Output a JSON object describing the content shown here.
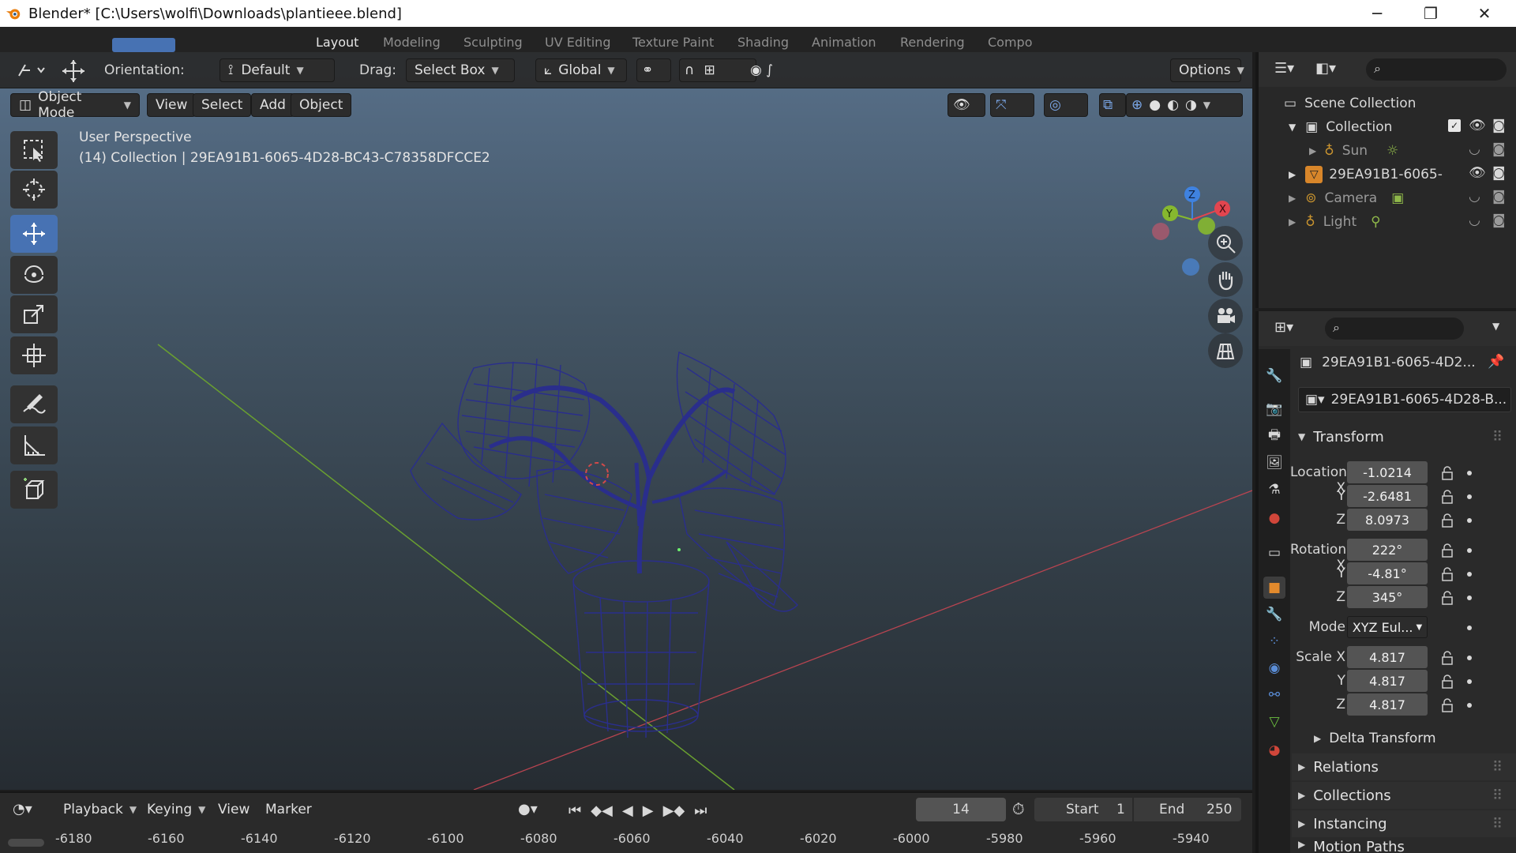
{
  "window": {
    "title": "Blender* [C:\\Users\\wolfi\\Downloads\\plantieee.blend]",
    "minimize_glyph": "─",
    "restore_glyph": "❐",
    "close_glyph": "✕"
  },
  "workspace_tabs": [
    "Layout",
    "Modeling",
    "Sculpting",
    "UV Editing",
    "Texture Paint",
    "Shading",
    "Animation",
    "Rendering",
    "Compo"
  ],
  "viewport_header": {
    "orientation_label": "Orientation:",
    "orientation_value": "Default",
    "drag_label": "Drag:",
    "drag_value": "Select Box",
    "transform_space": "Global",
    "options_label": "Options"
  },
  "mode_row": {
    "mode": "Object Mode",
    "menus": [
      "View",
      "Select",
      "Add",
      "Object"
    ]
  },
  "viewport": {
    "perspective_label": "User Perspective",
    "collection_label": "(14) Collection | 29EA91B1-6065-4D28-BC43-C78358DFCCE2",
    "gizmo": {
      "x": "X",
      "y": "Y",
      "z": "Z"
    }
  },
  "toolbar_icons": [
    "select-box-icon",
    "cursor-icon",
    "move-icon",
    "rotate-icon",
    "scale-icon",
    "transform-icon",
    "annotate-icon",
    "measure-icon",
    "add-cube-icon"
  ],
  "nav_icons": [
    "zoom-icon",
    "hand-pan-icon",
    "camera-view-icon",
    "ortho-grid-icon"
  ],
  "outliner": {
    "scene_collection": "Scene Collection",
    "items": [
      {
        "label": "Collection",
        "type": "collection"
      },
      {
        "label": "Sun",
        "type": "light"
      },
      {
        "label": "29EA91B1-6065-",
        "type": "mesh"
      },
      {
        "label": "Camera",
        "type": "camera"
      },
      {
        "label": "Light",
        "type": "light"
      }
    ]
  },
  "properties": {
    "object_name": "29EA91B1-6065-4D2...",
    "object_datablock": "29EA91B1-6065-4D28-B...",
    "transform_title": "Transform",
    "location_label": "Location X",
    "rotation_label": "Rotation X",
    "scale_label": "Scale X",
    "y_label": "Y",
    "z_label": "Z",
    "location": [
      "-1.0214",
      "-2.6481",
      "8.0973"
    ],
    "rotation": [
      "222°",
      "-4.81°",
      "345°"
    ],
    "mode_label": "Mode",
    "mode_value": "XYZ Eul...",
    "scale": [
      "4.817",
      "4.817",
      "4.817"
    ],
    "subpanels": [
      "Delta Transform",
      "Relations",
      "Collections",
      "Instancing",
      "Motion Paths"
    ]
  },
  "timeline": {
    "menus": [
      "Playback",
      "Keying",
      "View",
      "Marker"
    ],
    "current_frame": "14",
    "start_label": "Start",
    "start_value": "1",
    "end_label": "End",
    "end_value": "250",
    "ruler": [
      "-6180",
      "-6160",
      "-6140",
      "-6120",
      "-6100",
      "-6080",
      "-6060",
      "-6040",
      "-6020",
      "-6000",
      "-5980",
      "-5960",
      "-5940"
    ]
  },
  "colors": {
    "accent": "#4772b3",
    "x_axis": "#e2454f",
    "y_axis": "#86b82f",
    "z_axis": "#3f82e0",
    "wire": "#2a2e8c"
  }
}
